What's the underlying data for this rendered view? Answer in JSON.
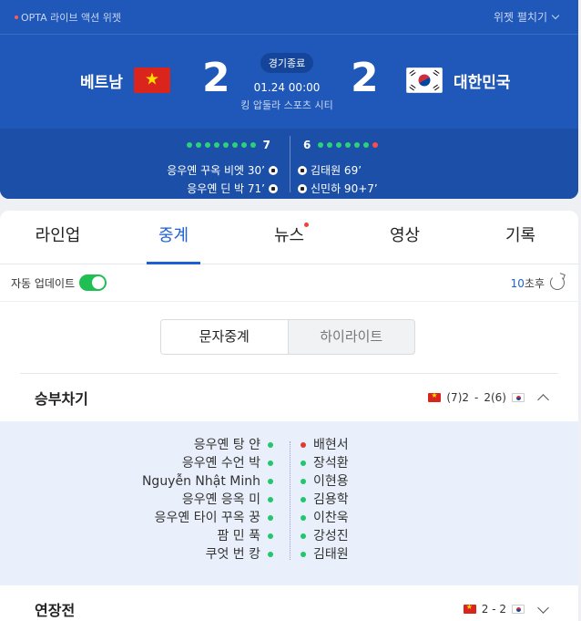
{
  "widget": {
    "brand": "OPTA 라이브 액션 위젯",
    "expand_label": "위젯 펼치기"
  },
  "match": {
    "home": {
      "name": "베트남",
      "score": "2",
      "flag": "vietnam-flag"
    },
    "away": {
      "name": "대한민국",
      "score": "2",
      "flag": "korea-flag"
    },
    "status": "경기종료",
    "datetime": "01.24 00:00",
    "venue": "킹 압둘라 스포츠 시티"
  },
  "stats": {
    "home_count": "7",
    "away_count": "6",
    "home_dots": [
      "goal",
      "goal",
      "goal",
      "goal",
      "goal",
      "goal",
      "goal",
      "goal"
    ],
    "away_dots": [
      "goal",
      "goal",
      "goal",
      "goal",
      "goal",
      "goal",
      "miss"
    ],
    "home_scorers": [
      "응우옌 꾸옥 비엣 30’",
      "응우옌 딘 박 71’"
    ],
    "away_scorers": [
      "김태원 69’",
      "신민하 90+7’"
    ]
  },
  "tabs": [
    "라인업",
    "중계",
    "뉴스",
    "영상",
    "기록"
  ],
  "autoupdate": {
    "label": "자동 업데이트",
    "seconds": "10",
    "unit": "초후"
  },
  "segment": [
    "문자중계",
    "하이라이트"
  ],
  "penalty": {
    "title": "승부차기",
    "home_score": "(7)2",
    "away_score": "2(6)",
    "separator": "-",
    "home_takers": [
      "응우옌 탕 얀",
      "응우옌 수언 박",
      "Nguyễn Nhật Minh",
      "응우옌 응옥 미",
      "응우옌 타이 꾸옥 꿍",
      "팜 민 푹",
      "쿠엇 번 캉"
    ],
    "away_takers": [
      "배현서",
      "장석환",
      "이현용",
      "김용학",
      "이찬욱",
      "강성진",
      "김태원"
    ],
    "home_results": [
      "goal",
      "goal",
      "goal",
      "goal",
      "goal",
      "goal",
      "goal"
    ],
    "away_results": [
      "miss",
      "goal",
      "goal",
      "goal",
      "goal",
      "goal",
      "goal"
    ]
  },
  "extra_time": {
    "title": "연장전",
    "score": "2 - 2"
  },
  "colors": {
    "header_blue": "#1f58b8",
    "accent_blue": "#1d5fd6",
    "goal_green": "#21c76b",
    "miss_red": "#e23a2d"
  }
}
